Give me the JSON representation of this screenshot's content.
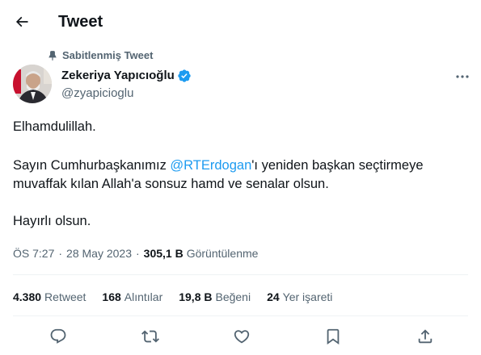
{
  "header": {
    "title": "Tweet"
  },
  "pinned": {
    "label": "Sabitlenmiş Tweet"
  },
  "author": {
    "name": "Zekeriya Yapıcıoğlu",
    "handle": "@zyapicioglu",
    "verified_color": "#1d9bf0"
  },
  "tweet": {
    "p1": "Elhamdulillah.",
    "p2_before": "Sayın Cumhurbaşkanımız ",
    "mention": "@RTErdogan",
    "p2_after": "'ı yeniden başkan seçtirmeye muvaffak kılan Allah'a sonsuz hamd ve senalar olsun.",
    "p3": "Hayırlı olsun."
  },
  "meta": {
    "time": "ÖS 7:27",
    "date": "28 May 2023",
    "views": "305,1 B",
    "views_label": "Görüntülenme",
    "separator": "·"
  },
  "stats": {
    "retweets": "4.380",
    "retweets_label": "Retweet",
    "quotes": "168",
    "quotes_label": "Alıntılar",
    "likes": "19,8 B",
    "likes_label": "Beğeni",
    "bookmarks": "24",
    "bookmarks_label": "Yer işareti"
  },
  "icons": {
    "back": "arrow-left-icon",
    "pin": "pin-icon",
    "verified": "verified-badge-icon",
    "more": "more-dots-icon",
    "reply": "reply-icon",
    "retweet": "retweet-icon",
    "like": "heart-icon",
    "bookmark": "bookmark-icon",
    "share": "share-icon"
  },
  "colors": {
    "text": "#0f1419",
    "secondary": "#536471",
    "accent": "#1d9bf0",
    "divider": "#eff3f4"
  }
}
